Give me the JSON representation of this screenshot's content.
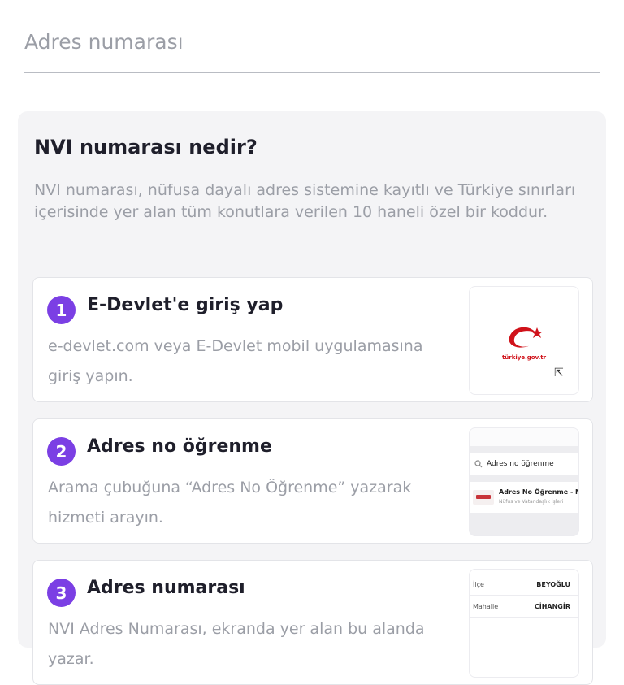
{
  "address_input": {
    "placeholder": "Adres numarası",
    "value": ""
  },
  "info": {
    "title": "NVI numarası nedir?",
    "description": "NVI numarası, nüfusa dayalı adres sistemine kayıtlı ve Türkiye sınırları içerisinde yer alan tüm konutlara verilen 10 haneli özel bir koddur."
  },
  "steps": [
    {
      "number": "1",
      "title": "E-Devlet'e giriş yap",
      "description": "e-devlet.com veya E-Devlet mobil uygulamasına giriş yapın.",
      "thumbnail": {
        "logo_text": "türkiye.gov.tr",
        "logo_color": "#d0121a"
      }
    },
    {
      "number": "2",
      "title": "Adres no öğrenme",
      "description": "Arama çubuğuna “Adres No Öğrenme” yazarak hizmeti arayın.",
      "thumbnail": {
        "search_text": "Adres no öğrenme",
        "result_title": "Adres No Öğrenme - NVİ",
        "result_subtitle": "Nüfus ve Vatandaşlık İşleri"
      }
    },
    {
      "number": "3",
      "title": "Adres numarası",
      "description": "NVI Adres Numarası, ekranda yer alan bu alanda yazar.",
      "thumbnail": {
        "rows": [
          {
            "key": "İlçe",
            "value": "BEYOĞLU"
          },
          {
            "key": "Mahalle",
            "value": "CİHANGİR"
          }
        ]
      }
    }
  ],
  "colors": {
    "accent": "#7b3fe4",
    "card_bg": "#f4f4f6",
    "muted_text": "#9b9ea6"
  }
}
